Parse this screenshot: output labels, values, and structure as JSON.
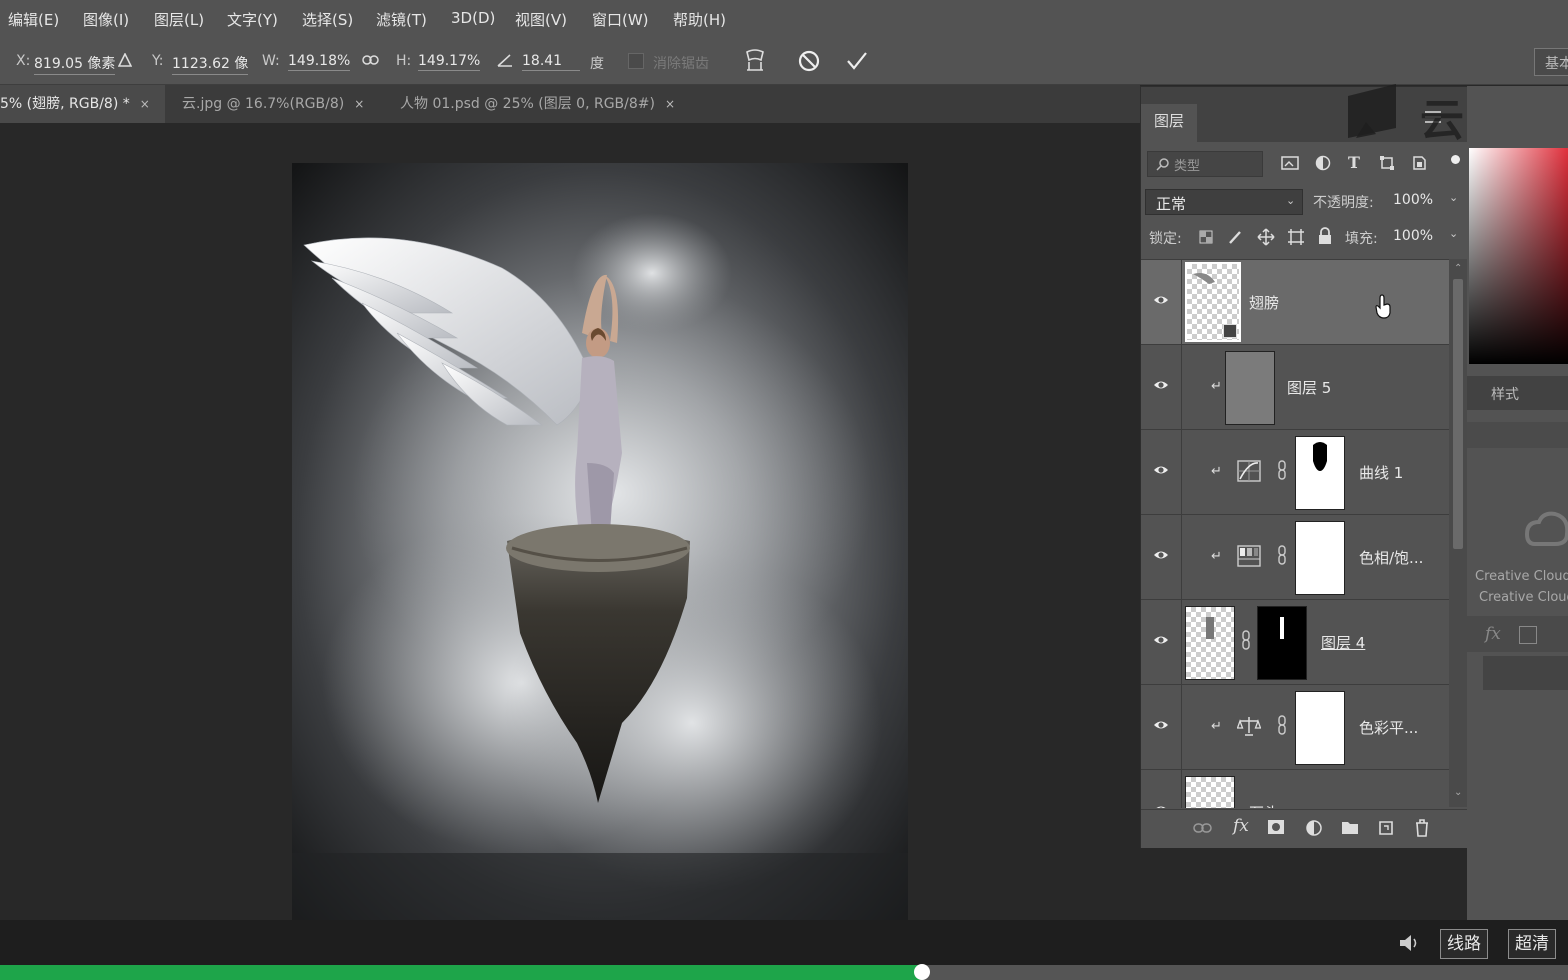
{
  "menu": [
    "编辑(E)",
    "图像(I)",
    "图层(L)",
    "文字(Y)",
    "选择(S)",
    "滤镜(T)",
    "3D(D)",
    "视图(V)",
    "窗口(W)",
    "帮助(H)"
  ],
  "options": {
    "x_label": "X:",
    "x_value": "819.05 像素",
    "y_label": "Y:",
    "y_value": "1123.62 像",
    "w_label": "W:",
    "w_value": "149.18%",
    "h_label": "H:",
    "h_value": "149.17%",
    "angle_value": "18.41",
    "angle_unit": "度",
    "antialias_label": "消除锯齿",
    "workspace_label": "基本"
  },
  "tabs": [
    {
      "label": "5% (翅膀, RGB/8) *",
      "close": "×",
      "active": true
    },
    {
      "label": "云.jpg @ 16.7%(RGB/8)",
      "close": "×",
      "active": false
    },
    {
      "label": "人物 01.psd @ 25% (图层 0, RGB/8#)",
      "close": "×",
      "active": false
    }
  ],
  "layers_panel": {
    "tab_label": "图层",
    "filter_placeholder": "类型",
    "blend_mode": "正常",
    "opacity_label": "不透明度:",
    "opacity_value": "100%",
    "lock_label": "锁定:",
    "fill_label": "填充:",
    "fill_value": "100%",
    "layers": [
      {
        "name": "翅膀",
        "type": "smart-object",
        "selected": true
      },
      {
        "name": "图层 5",
        "type": "clipped-pixel"
      },
      {
        "name": "曲线 1",
        "type": "curves-adjustment"
      },
      {
        "name": "色相/饱...",
        "type": "hue-saturation-adjustment"
      },
      {
        "name": "图层 4",
        "type": "pixel-with-mask"
      },
      {
        "name": "色彩平...",
        "type": "color-balance-adjustment"
      },
      {
        "name": "石头",
        "type": "pixel"
      }
    ]
  },
  "right_panel": {
    "styles_tab": "样式",
    "cc_line1": "Creative Cloud",
    "cc_line2": "Creative Cloud",
    "fx_label": "fx"
  },
  "watermark": "云课堂",
  "player": {
    "route_label": "线路",
    "quality_label": "超清",
    "progress": 0.588
  },
  "colors": {
    "progress_green": "#1ea54a",
    "panel_bg": "#535353"
  }
}
